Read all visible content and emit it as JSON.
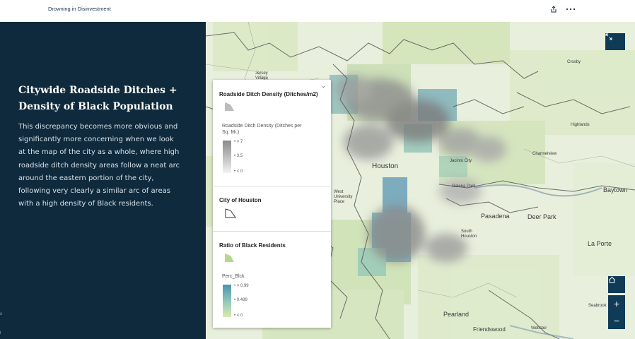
{
  "header": {
    "story_title": "Drowning in Disinvestment",
    "share_icon": "share-icon",
    "more_icon": "more-options-icon"
  },
  "sidebar": {
    "title_line1": "Citywide Roadside Ditches +",
    "title_line2": "Density of Black Population",
    "body_lines": [
      "This discrepancy becomes more obvious and",
      "significantly more concerning when we look",
      "at the map of the city as a whole, where high",
      "roadside ditch density areas follow a neat arc",
      "around the eastern portion of the city,",
      "following very clearly a similar arc of areas",
      "with a high density of Black residents."
    ],
    "edge_marks": [
      "s",
      "l"
    ]
  },
  "legend": {
    "section1": {
      "title": "Roadside Ditch Density (Ditches/m2)",
      "field_label_line1": "Roadside Ditch Density (Ditches per",
      "field_label_line2": "Sq. Mi.)",
      "ramp_labels": [
        "> 7",
        "3.5",
        "< 0"
      ]
    },
    "section2": {
      "title": "City of Houston"
    },
    "section3": {
      "title": "Ratio of Black Residents",
      "field_label": "Perc_Blck",
      "ramp_labels": [
        "> 0.99",
        "0.499",
        "< 0"
      ]
    },
    "colors": {
      "gray_ramp_top": "#8a8a8a",
      "gray_ramp_bottom": "#f2f2f2",
      "teal_ramp_top": "#4a92b0",
      "teal_ramp_mid": "#8fc7b9",
      "teal_ramp_bottom": "#d9ecb0",
      "green_swatch": "#b5d98a"
    }
  },
  "map": {
    "labels": {
      "houston": "Houston",
      "pasadena": "Pasadena",
      "deer_park": "Deer Park",
      "la_porte": "La Porte",
      "baytown": "Baytown",
      "pearland": "Pearland",
      "friendswood": "Friendswood",
      "webster": "Webster",
      "crosby": "Crosby",
      "highlands": "Highlands",
      "channelview": "Channelview",
      "jacinto_city": "Jacinto City",
      "galena_park": "Galena Park",
      "south_houston_1": "South",
      "south_houston_2": "Houston",
      "jersey_1": "Jersey",
      "jersey_2": "Village",
      "west_uni_1": "West",
      "west_uni_2": "University",
      "west_uni_3": "Place",
      "seabrook": "Seabrook"
    },
    "controls": {
      "expand_icon": "expand-icon",
      "home_icon": "home-icon",
      "zoom_in": "+",
      "zoom_out": "−"
    },
    "colors": {
      "sidebar_bg": "#0f2a3d",
      "button_bg": "#0f3b57",
      "map_bg": "#e6ecd9"
    }
  }
}
